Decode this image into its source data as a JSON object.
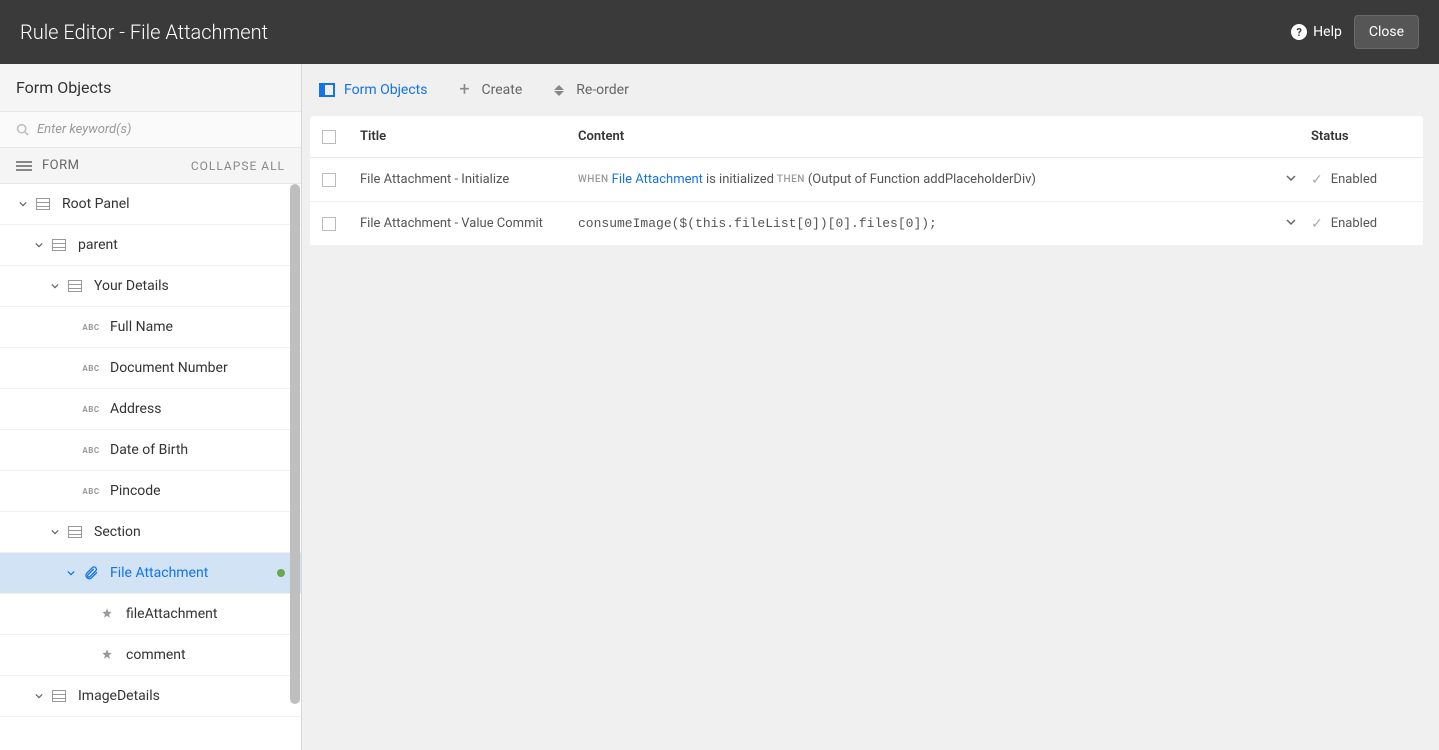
{
  "header": {
    "title": "Rule Editor - File Attachment",
    "help": "Help",
    "close": "Close"
  },
  "leftPanel": {
    "title": "Form Objects",
    "searchPlaceholder": "Enter keyword(s)",
    "formLabel": "FORM",
    "collapseAll": "COLLAPSE ALL"
  },
  "tree": {
    "rootPanel": "Root Panel",
    "parent": "parent",
    "yourDetails": "Your Details",
    "fullName": "Full Name",
    "documentNumber": "Document Number",
    "address": "Address",
    "dateOfBirth": "Date of Birth",
    "pincode": "Pincode",
    "section": "Section",
    "fileAttachment": "File Attachment",
    "fileAttachmentChild": "fileAttachment",
    "comment": "comment",
    "imageDetails": "ImageDetails"
  },
  "toolbar": {
    "formObjects": "Form Objects",
    "create": "Create",
    "reorder": "Re-order"
  },
  "table": {
    "headers": {
      "title": "Title",
      "content": "Content",
      "status": "Status"
    },
    "rows": [
      {
        "title": "File Attachment - Initialize",
        "when": "WHEN",
        "link": "File Attachment",
        "mid": " is initialized ",
        "then": "THEN",
        "after": " (Output of Function addPlaceholderDiv)",
        "status": "Enabled",
        "isCode": false
      },
      {
        "title": "File Attachment - Value Commit",
        "code": "consumeImage($(this.fileList[0])[0].files[0]);",
        "status": "Enabled",
        "isCode": true
      }
    ]
  }
}
